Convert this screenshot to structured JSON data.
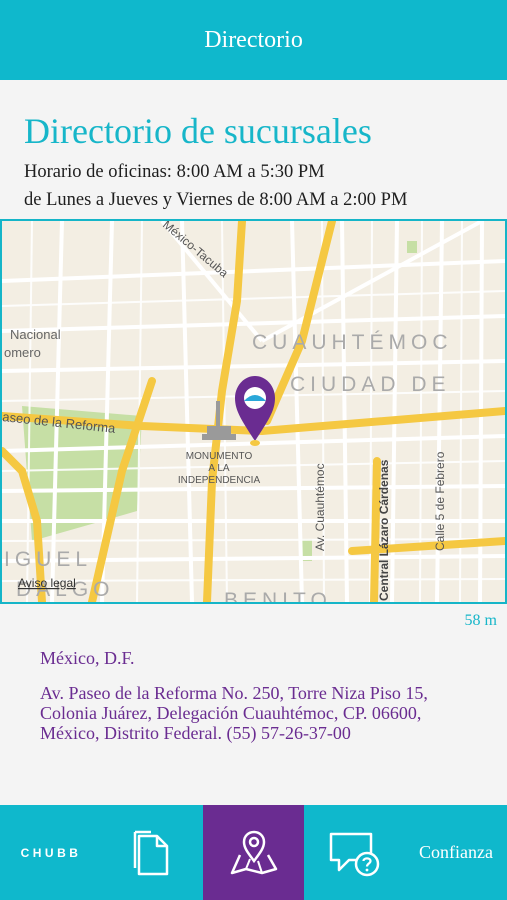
{
  "header": {
    "title": "Directorio"
  },
  "page": {
    "title": "Directorio de sucursales",
    "hours_line1": "Horario de oficinas: 8:00 AM a 5:30 PM",
    "hours_line2": "de Lunes a Jueves y Viernes de 8:00 AM a 2:00 PM"
  },
  "map": {
    "labels": {
      "cuauhtemoc": "CUAUHTÉMOC",
      "ciudad": "CIUDAD DE",
      "monumento_1": "MONUMENTO",
      "monumento_2": "A LA",
      "monumento_3": "INDEPENDENCIA",
      "nacional": "Nacional",
      "omero": "omero",
      "reforma": "aseo de la Reforma",
      "mexico_tacuba": "México-Tacuba",
      "av_cuauhtemoc": "Av. Cuauhtémoc",
      "lazaro": "Central Lázaro Cárdenas",
      "calle5": "Calle 5 de Febrero",
      "miguel": "IGUEL",
      "dalgo": "DALGO",
      "benito": "BENITO",
      "aviso": "Aviso legal"
    },
    "scale": "58 m",
    "colors": {
      "background": "#f3eee3",
      "major_road": "#f5c842",
      "minor_road": "#ffffff",
      "park": "#c6dfa5",
      "pin": "#6a2c91"
    }
  },
  "branch": {
    "city": "México, D.F.",
    "address_line1": "Av. Paseo de la Reforma No. 250, Torre Niza Piso 15,",
    "address_line2": "Colonia Juárez, Delegación Cuauhtémoc, CP. 06600,",
    "address_line3": "México, Distrito Federal. (55) 57-26-37-00"
  },
  "tabbar": {
    "brand": "CHUBB",
    "trust": "Confianza",
    "items": [
      {
        "icon": "document-icon"
      },
      {
        "icon": "map-pin-icon",
        "active": true
      },
      {
        "icon": "chat-question-icon"
      }
    ],
    "colors": {
      "bar": "#0fb8cc",
      "active": "#6a2c91"
    }
  }
}
